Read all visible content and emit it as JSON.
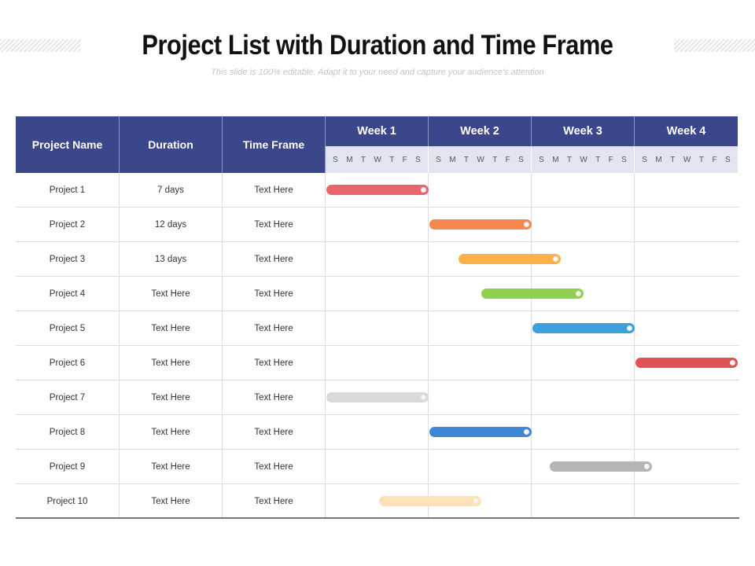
{
  "header": {
    "title": "Project List with Duration and Time Frame",
    "subtitle": "This slide is 100% editable. Adapt it to your need and capture your audience's attention"
  },
  "table": {
    "columns": [
      "Project Name",
      "Duration",
      "Time Frame"
    ],
    "weeks": [
      "Week 1",
      "Week 2",
      "Week 3",
      "Week 4"
    ],
    "day_labels": [
      "S",
      "M",
      "T",
      "W",
      "T",
      "F",
      "S"
    ],
    "rows": [
      {
        "name": "Project 1",
        "duration": "7 days",
        "time_frame": "Text Here"
      },
      {
        "name": "Project 2",
        "duration": "12 days",
        "time_frame": "Text Here"
      },
      {
        "name": "Project 3",
        "duration": "13 days",
        "time_frame": "Text Here"
      },
      {
        "name": "Project 4",
        "duration": "Text Here",
        "time_frame": "Text Here"
      },
      {
        "name": "Project 5",
        "duration": "Text Here",
        "time_frame": "Text Here"
      },
      {
        "name": "Project 6",
        "duration": "Text Here",
        "time_frame": "Text Here"
      },
      {
        "name": "Project 7",
        "duration": "Text Here",
        "time_frame": "Text Here"
      },
      {
        "name": "Project 8",
        "duration": "Text Here",
        "time_frame": "Text Here"
      },
      {
        "name": "Project 9",
        "duration": "Text Here",
        "time_frame": "Text Here"
      },
      {
        "name": "Project 10",
        "duration": "Text Here",
        "time_frame": "Text Here"
      }
    ]
  },
  "chart_data": {
    "type": "gantt",
    "title": "Project List with Duration and Time Frame",
    "x_unit": "days",
    "x_range": [
      0,
      28
    ],
    "categories": [
      "Week 1",
      "Week 2",
      "Week 3",
      "Week 4"
    ],
    "tasks": [
      {
        "name": "Project 1",
        "start_day": 0,
        "end_day": 7,
        "color": "#e8656e"
      },
      {
        "name": "Project 2",
        "start_day": 7,
        "end_day": 14,
        "color": "#f5874f"
      },
      {
        "name": "Project 3",
        "start_day": 9,
        "end_day": 16,
        "color": "#fbb147"
      },
      {
        "name": "Project 4",
        "start_day": 10.5,
        "end_day": 17.5,
        "color": "#8ecf4d"
      },
      {
        "name": "Project 5",
        "start_day": 14,
        "end_day": 21,
        "color": "#3aa1dc"
      },
      {
        "name": "Project 6",
        "start_day": 21,
        "end_day": 28,
        "color": "#e05258"
      },
      {
        "name": "Project 7",
        "start_day": 0,
        "end_day": 7,
        "color": "#d9d9d9"
      },
      {
        "name": "Project 8",
        "start_day": 7,
        "end_day": 14,
        "color": "#3d87d6"
      },
      {
        "name": "Project 9",
        "start_day": 15.2,
        "end_day": 22.2,
        "color": "#b5b5b5"
      },
      {
        "name": "Project 10",
        "start_day": 3.6,
        "end_day": 10.6,
        "color": "#fde1b8"
      }
    ]
  },
  "colors": {
    "header_bg": "#3b468b",
    "days_bg": "#e2e4f0"
  }
}
